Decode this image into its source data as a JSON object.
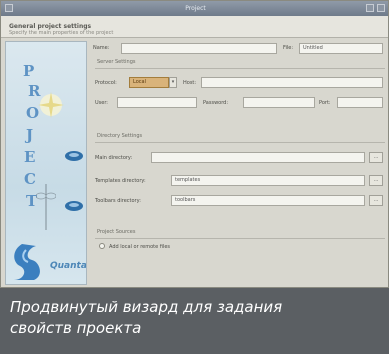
{
  "window": {
    "title": "Project",
    "menu_title": "General project settings",
    "menu_subtitle": "Specify the main properties of the project"
  },
  "sidebar": {
    "logo_letters": [
      "P",
      "R",
      "O",
      "J",
      "E",
      "C",
      "T"
    ],
    "logo_text": "Quanta"
  },
  "form": {
    "name_label": "Name:",
    "name_value": "",
    "file_label": "File:",
    "file_value": "Untitled",
    "server_group": "Server Settings",
    "protocol_label": "Protocol:",
    "protocol_value": "Local",
    "host_label": "Host:",
    "host_value": "",
    "user_label": "User:",
    "user_value": "",
    "password_label": "Password:",
    "password_value": "",
    "port_label": "Port:",
    "port_value": "",
    "directory_group": "Directory Settings",
    "main_dir_label": "Main directory:",
    "main_dir_value": "",
    "templates_dir_label": "Templates directory:",
    "templates_dir_value": "templates",
    "toolbars_dir_label": "Toolbars directory:",
    "toolbars_dir_value": "toolbars",
    "browse_label": "...",
    "sources_group": "Project Sources",
    "sources_option": "Add local or remote files"
  },
  "caption": {
    "line1": "Продвинутый визард для задания",
    "line2": "свойств проекта"
  },
  "colors": {
    "caption_bg": "#5b5f63",
    "window_bg": "#d8d7cf",
    "logo_blue": "#5e93c4",
    "accent_orange": "#d9b37a"
  }
}
